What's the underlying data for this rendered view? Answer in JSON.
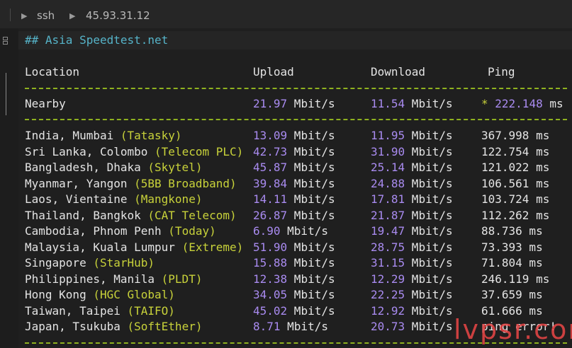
{
  "titlebar": {
    "item1": "ssh",
    "item2": "45.93.31.12"
  },
  "heading": "## Asia Speedtest.net",
  "header": {
    "location": "Location",
    "upload": "Upload",
    "download": "Download",
    "ping": "Ping"
  },
  "nearby": {
    "location": "Nearby",
    "upload_value": "21.97",
    "upload_unit": " Mbit/s",
    "download_value": "11.54",
    "download_unit": " Mbit/s",
    "star": "*",
    "ping_value": " 222.148",
    "ping_unit": " ms"
  },
  "rows": [
    {
      "place": "India, Mumbai ",
      "isp": "(Tatasky)",
      "up": "13.09",
      "up_unit": " Mbit/s",
      "down": "11.95",
      "down_unit": " Mbit/s",
      "ping": "367.998 ms"
    },
    {
      "place": "Sri Lanka, Colombo ",
      "isp": "(Telecom PLC)",
      "up": "42.73",
      "up_unit": " Mbit/s",
      "down": "31.90",
      "down_unit": " Mbit/s",
      "ping": "122.754 ms"
    },
    {
      "place": "Bangladesh, Dhaka ",
      "isp": "(Skytel)",
      "up": "45.87",
      "up_unit": " Mbit/s",
      "down": "25.14",
      "down_unit": " Mbit/s",
      "ping": "121.022 ms"
    },
    {
      "place": "Myanmar, Yangon ",
      "isp": "(5BB Broadband)",
      "up": "39.84",
      "up_unit": " Mbit/s",
      "down": "24.88",
      "down_unit": " Mbit/s",
      "ping": "106.561 ms"
    },
    {
      "place": "Laos, Vientaine ",
      "isp": "(Mangkone)",
      "up": "14.11",
      "up_unit": " Mbit/s",
      "down": "17.81",
      "down_unit": " Mbit/s",
      "ping": "103.724 ms"
    },
    {
      "place": "Thailand, Bangkok ",
      "isp": "(CAT Telecom)",
      "up": "26.87",
      "up_unit": " Mbit/s",
      "down": "21.87",
      "down_unit": " Mbit/s",
      "ping": "112.262 ms"
    },
    {
      "place": "Cambodia, Phnom Penh ",
      "isp": "(Today)",
      "up": "6.90",
      "up_unit": " Mbit/s",
      "down": "19.47",
      "down_unit": " Mbit/s",
      "ping": "88.736 ms"
    },
    {
      "place": "Malaysia, Kuala Lumpur ",
      "isp": "(Extreme)",
      "up": "51.90",
      "up_unit": " Mbit/s",
      "down": "28.75",
      "down_unit": " Mbit/s",
      "ping": "73.393 ms"
    },
    {
      "place": "Singapore ",
      "isp": "(StarHub)",
      "up": "15.88",
      "up_unit": " Mbit/s",
      "down": "31.15",
      "down_unit": " Mbit/s",
      "ping": "71.804 ms"
    },
    {
      "place": "Philippines, Manila ",
      "isp": "(PLDT)",
      "up": "12.38",
      "up_unit": " Mbit/s",
      "down": "12.29",
      "down_unit": " Mbit/s",
      "ping": "246.119 ms"
    },
    {
      "place": "Hong Kong ",
      "isp": "(HGC Global)",
      "up": "34.05",
      "up_unit": " Mbit/s",
      "down": "22.25",
      "down_unit": " Mbit/s",
      "ping": "37.659 ms"
    },
    {
      "place": "Taiwan, Taipei ",
      "isp": "(TAIFO)",
      "up": "45.02",
      "up_unit": " Mbit/s",
      "down": "12.92",
      "down_unit": " Mbit/s",
      "ping": "61.666 ms"
    },
    {
      "place": "Japan, Tsukuba ",
      "isp": "(SoftEther)",
      "up": "8.71",
      "up_unit": " Mbit/s",
      "down": "20.73",
      "down_unit": " Mbit/s",
      "ping": "ping error!"
    }
  ],
  "watermark": "lvpsr.com"
}
